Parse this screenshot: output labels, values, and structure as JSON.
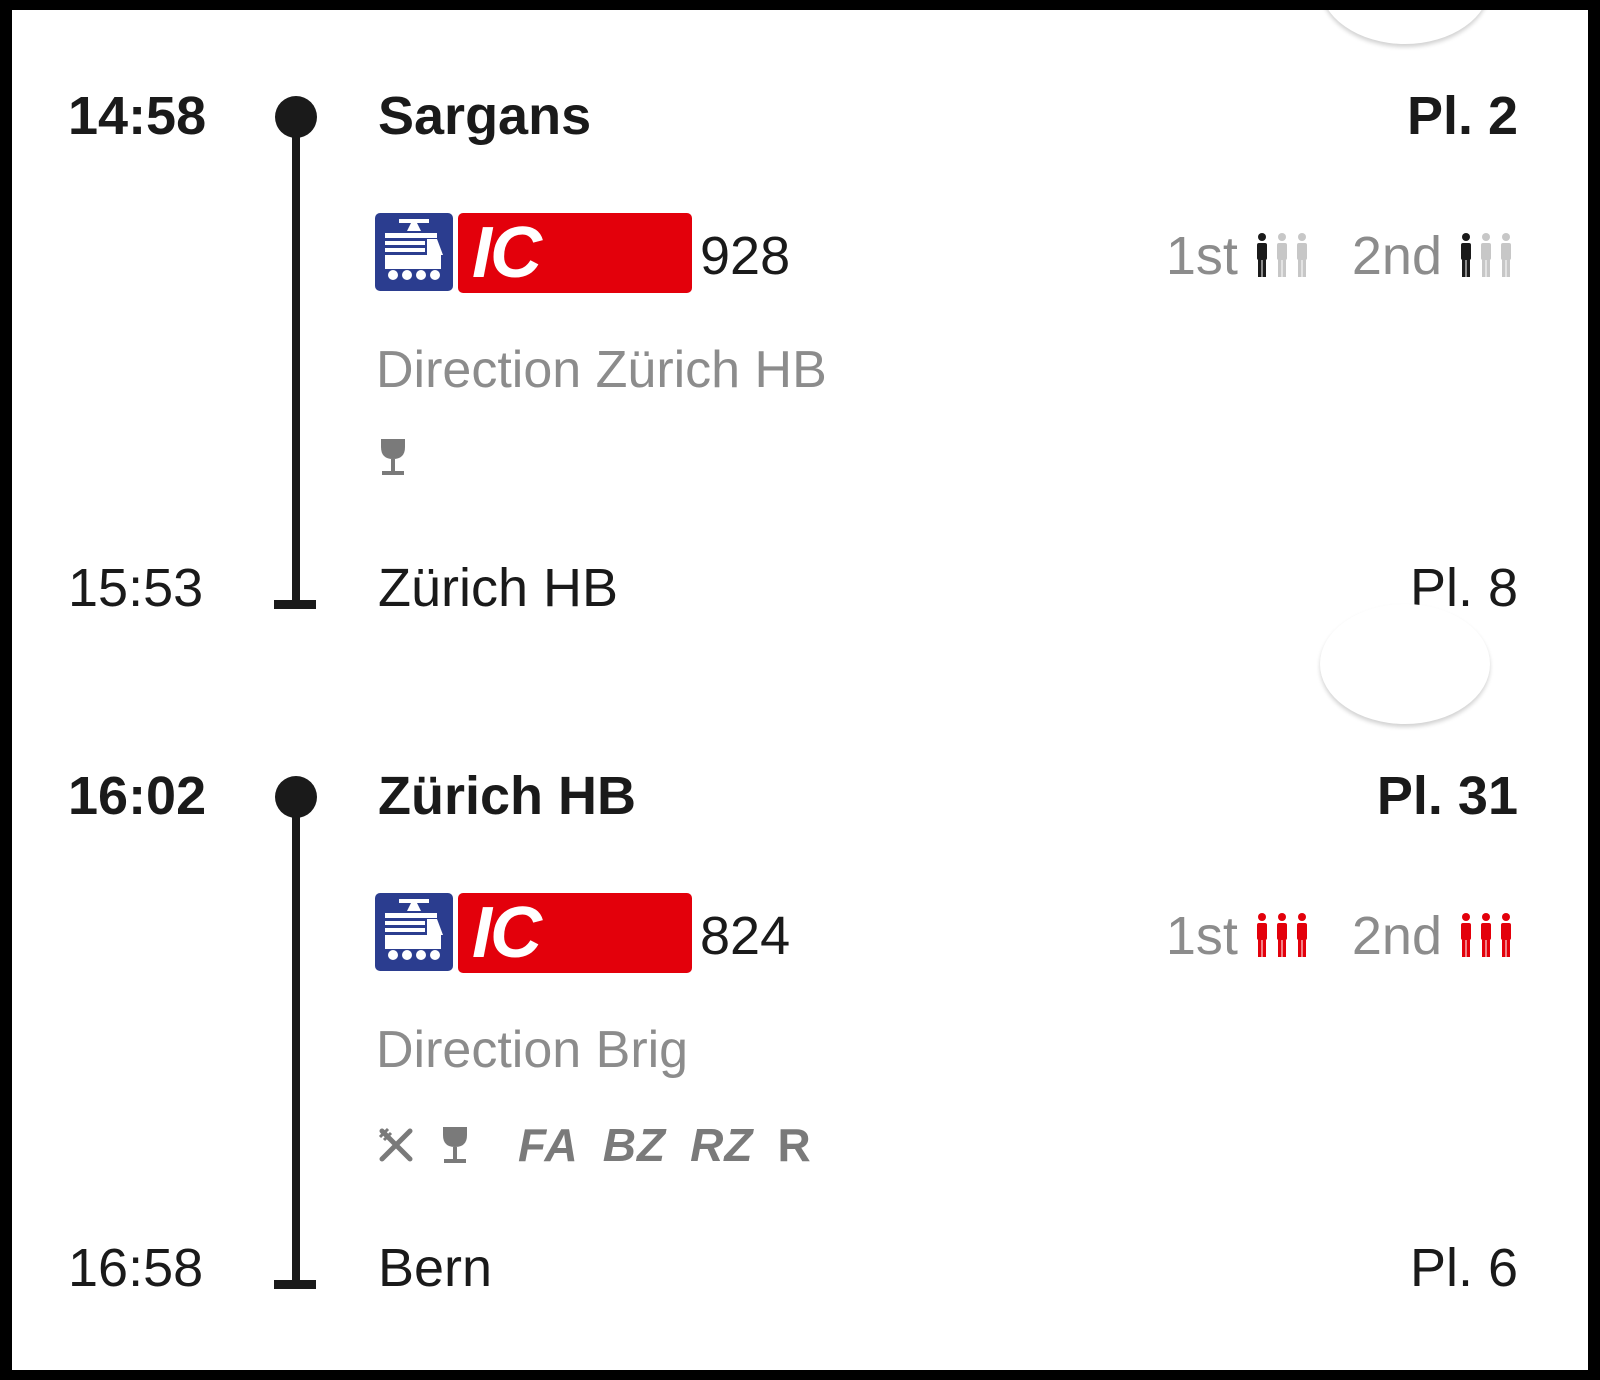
{
  "legs": [
    {
      "departure": {
        "time": "14:58",
        "station": "Sargans",
        "platform": "Pl. 2"
      },
      "train": {
        "category": "IC",
        "number": "928",
        "category_color": "#e3000b",
        "icon": "train-icon"
      },
      "occupancy": {
        "first_label": "1st",
        "first_level": 1,
        "first_color": "#1a1a1a",
        "second_label": "2nd",
        "second_level": 1,
        "second_color": "#1a1a1a"
      },
      "direction": "Direction Zürich HB",
      "services": [
        "wine-glass-icon"
      ],
      "service_codes": [],
      "arrival": {
        "time": "15:53",
        "station": "Zürich HB",
        "platform": "Pl. 8"
      }
    },
    {
      "departure": {
        "time": "16:02",
        "station": "Zürich HB",
        "platform": "Pl. 31"
      },
      "train": {
        "category": "IC",
        "number": "824",
        "category_color": "#e3000b",
        "icon": "train-icon"
      },
      "occupancy": {
        "first_label": "1st",
        "first_level": 3,
        "first_color": "#e3000b",
        "second_label": "2nd",
        "second_level": 3,
        "second_color": "#e3000b"
      },
      "direction": "Direction Brig",
      "services": [
        "restaurant-icon",
        "wine-glass-icon"
      ],
      "service_codes": [
        "FA",
        "BZ",
        "RZ",
        "R"
      ],
      "arrival": {
        "time": "16:58",
        "station": "Bern",
        "platform": "Pl. 6"
      }
    }
  ],
  "colors": {
    "text": "#1a1a1a",
    "muted": "#8c8c8c",
    "ic_red": "#e3000b",
    "train_blue": "#2b3d8f"
  }
}
